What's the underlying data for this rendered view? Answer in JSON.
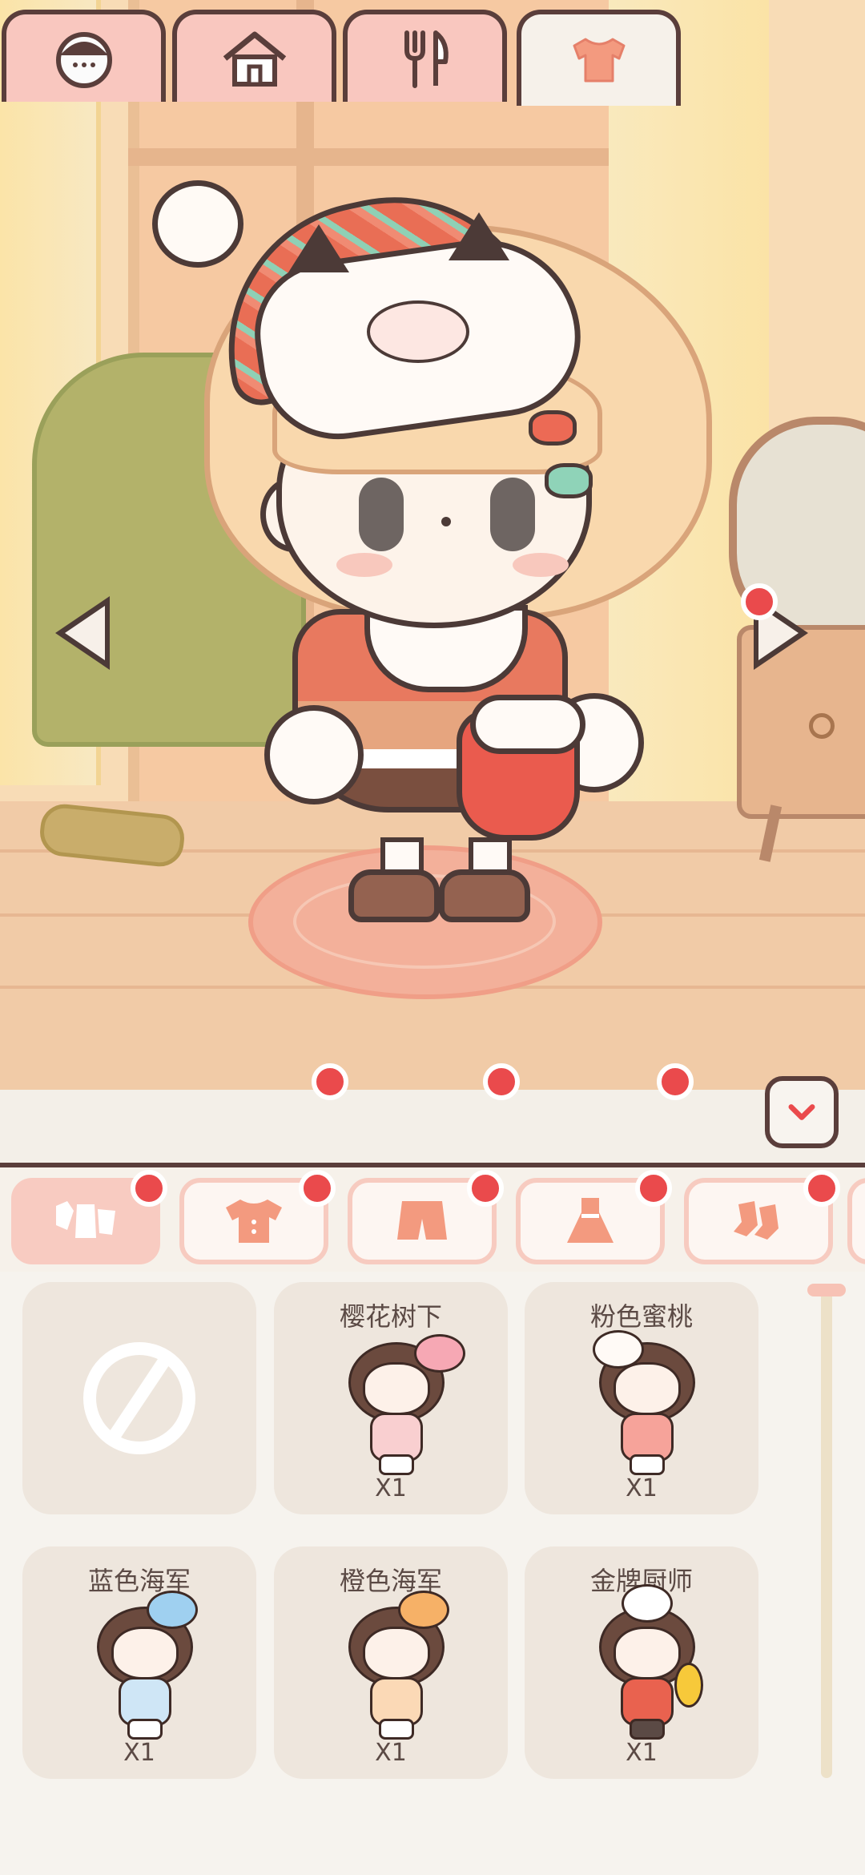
{
  "scene": {
    "prev_arrow": "left-arrow",
    "next_arrow": "right-arrow"
  },
  "category_tabs": [
    {
      "icon": "face-icon",
      "active": false,
      "badge": false
    },
    {
      "icon": "house-icon",
      "active": false,
      "badge": true
    },
    {
      "icon": "fork-knife-icon",
      "active": false,
      "badge": true
    },
    {
      "icon": "shirt-icon",
      "active": true,
      "badge": true
    }
  ],
  "collapse_icon": "chevron-down-icon",
  "sub_tabs": [
    {
      "icon": "all-clothes-icon",
      "active": true,
      "badge": true
    },
    {
      "icon": "top-icon",
      "active": false,
      "badge": true
    },
    {
      "icon": "shorts-icon",
      "active": false,
      "badge": true
    },
    {
      "icon": "dress-icon",
      "active": false,
      "badge": true
    },
    {
      "icon": "socks-icon",
      "active": false,
      "badge": true
    }
  ],
  "items": [
    {
      "name": "",
      "count": "",
      "icon": "none-icon"
    },
    {
      "name": "樱花树下",
      "count": "X1"
    },
    {
      "name": "粉色蜜桃",
      "count": "X1"
    },
    {
      "name": "蓝色海军",
      "count": "X1"
    },
    {
      "name": "橙色海军",
      "count": "X1"
    },
    {
      "name": "金牌厨师",
      "count": "X1"
    }
  ],
  "colors": {
    "accent": "#ea4a4c",
    "tab_pink": "#f9c7bf",
    "outline": "#5a3e3b",
    "card_bg": "#eee6dd"
  }
}
